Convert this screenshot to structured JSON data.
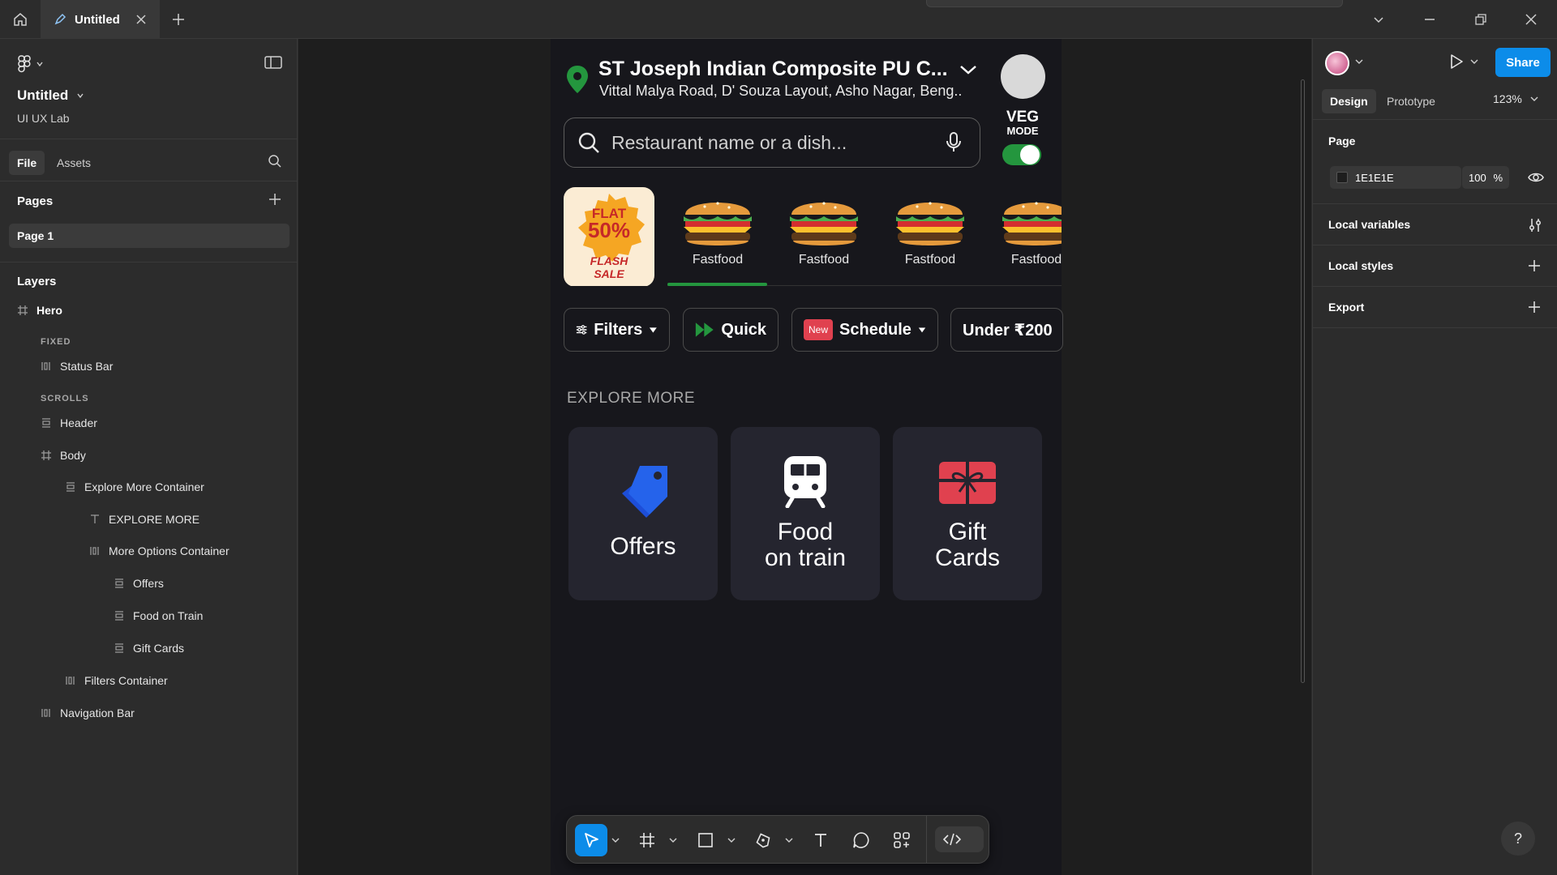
{
  "titlebar": {
    "tab_title": "Untitled"
  },
  "file": {
    "name": "Untitled",
    "team": "UI UX Lab"
  },
  "left_tabs": [
    "File",
    "Assets"
  ],
  "pages": {
    "title": "Pages",
    "items": [
      "Page 1"
    ]
  },
  "layers": {
    "title": "Layers",
    "items": [
      {
        "label": "Hero",
        "icon": "frame-icon"
      },
      {
        "label": "FIXED",
        "icon": "section-label"
      },
      {
        "label": "Status Bar",
        "icon": "horizontal-layout-icon"
      },
      {
        "label": "SCROLLS",
        "icon": "section-label"
      },
      {
        "label": "Header",
        "icon": "vertical-layout-icon"
      },
      {
        "label": "Body",
        "icon": "frame-icon"
      },
      {
        "label": "Explore More Container",
        "icon": "vertical-layout-icon"
      },
      {
        "label": "EXPLORE MORE",
        "icon": "text-icon"
      },
      {
        "label": "More Options Container",
        "icon": "horizontal-layout-icon"
      },
      {
        "label": "Offers",
        "icon": "vertical-layout-icon"
      },
      {
        "label": "Food on Train",
        "icon": "vertical-layout-icon"
      },
      {
        "label": "Gift Cards",
        "icon": "vertical-layout-icon"
      },
      {
        "label": "Filters Container",
        "icon": "horizontal-layout-icon"
      },
      {
        "label": "Navigation Bar",
        "icon": "horizontal-layout-icon"
      }
    ]
  },
  "app": {
    "location_title": "ST Joseph Indian Composite PU C...",
    "location_address": "Vittal Malya Road, D' Souza Layout, Asho Nagar, Beng..",
    "veg_mode_line1": "VEG",
    "veg_mode_line2": "MODE",
    "veg_mode_on": true,
    "search_placeholder": "Restaurant name or a dish...",
    "flash_sale": {
      "line1": "FLAT",
      "line2": "50%",
      "line3": "FLASH",
      "line4": "SALE"
    },
    "categories": [
      "Fastfood",
      "Fastfood",
      "Fastfood",
      "Fastfood"
    ],
    "chips": {
      "filters": "Filters",
      "quick": "Quick",
      "new_badge": "New",
      "schedule": "Schedule",
      "under": "Under ₹200"
    },
    "explore_title": "EXPLORE MORE",
    "options": {
      "offers": "Offers",
      "food_train_l1": "Food",
      "food_train_l2": "on train",
      "gift_l1": "Gift",
      "gift_l2": "Cards"
    },
    "colors": {
      "accent_green": "#24963e",
      "offers_blue": "#2563eb",
      "gift_red": "#e0414f"
    }
  },
  "right": {
    "share": "Share",
    "tabs": [
      "Design",
      "Prototype"
    ],
    "zoom": "123%",
    "page_section": "Page",
    "page_color": "1E1E1E",
    "page_opacity": "100",
    "percent": "%",
    "local_variables": "Local variables",
    "local_styles": "Local styles",
    "export": "Export",
    "help": "?"
  }
}
